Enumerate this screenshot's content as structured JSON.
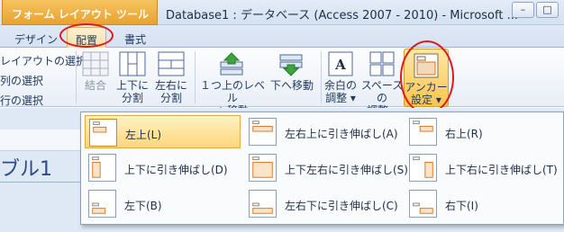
{
  "titlebar": {
    "context_tool": "フォーム レイアウト ツール",
    "window_title": "Database1 : データベース (Access 2007 - 2010) - Microsoft ...",
    "minimize": "–",
    "restore": "□"
  },
  "tabs": {
    "design": "デザイン",
    "layout": "配置",
    "format": "書式"
  },
  "ribbon": {
    "select_layout": "レイアウトの選択",
    "select_column": "列の選択",
    "select_row": "行の選択",
    "merge": "結合",
    "split_vertical": [
      "上下に",
      "分割"
    ],
    "split_horizontal": [
      "左右に",
      "分割"
    ],
    "move_up": [
      "１つ上のレベル",
      "へ移動"
    ],
    "move_down": [
      "下へ移動",
      ""
    ],
    "margins": [
      "余白の",
      "調整 ▾"
    ],
    "padding": [
      "スペースの",
      "調整 ▾"
    ],
    "anchor": [
      "アンカー",
      "設定 ▾"
    ]
  },
  "document": {
    "title_fragment": "ブル1"
  },
  "anchor_options": [
    {
      "label": "左上(L)",
      "icon": "anchor-top-left-icon"
    },
    {
      "label": "左右上に引き伸ばし(A)",
      "icon": "anchor-stretch-across-top-icon"
    },
    {
      "label": "右上(R)",
      "icon": "anchor-top-right-icon"
    },
    {
      "label": "上下に引き伸ばし(D)",
      "icon": "anchor-stretch-down-icon"
    },
    {
      "label": "上下左右に引き伸ばし(S)",
      "icon": "anchor-stretch-down-across-icon"
    },
    {
      "label": "上下右に引き伸ばし(T)",
      "icon": "anchor-stretch-down-right-icon"
    },
    {
      "label": "左下(B)",
      "icon": "anchor-bottom-left-icon"
    },
    {
      "label": "左右下に引き伸ばし(C)",
      "icon": "anchor-stretch-across-bottom-icon"
    },
    {
      "label": "右下(I)",
      "icon": "anchor-bottom-right-icon"
    }
  ],
  "selected_option": "左上(L)",
  "colors": {
    "accent_orange": "#f9c450",
    "annotation_red": "#e0191b",
    "ribbon_text": "#1e395b",
    "icon_orange": "#e0711a"
  }
}
